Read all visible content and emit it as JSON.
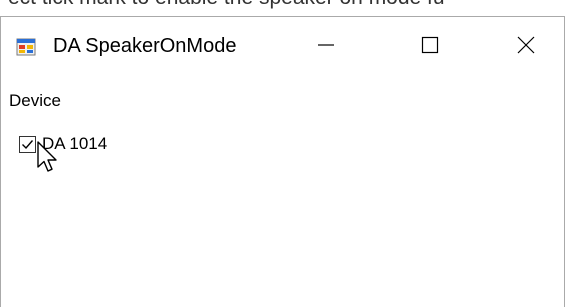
{
  "caption_text": "ect tick mark to enable the speaker on mode fu",
  "window": {
    "title": "DA SpeakerOnMode",
    "app_icon": "windows-form-app-icon",
    "buttons": {
      "minimize_icon": "minimize-icon",
      "maximize_icon": "maximize-icon",
      "close_icon": "close-icon"
    }
  },
  "content": {
    "device_label": "Device",
    "device_checkbox": {
      "label": "DA 1014",
      "checked": true
    }
  },
  "cursor": {
    "icon": "arrow-pointer-icon"
  }
}
